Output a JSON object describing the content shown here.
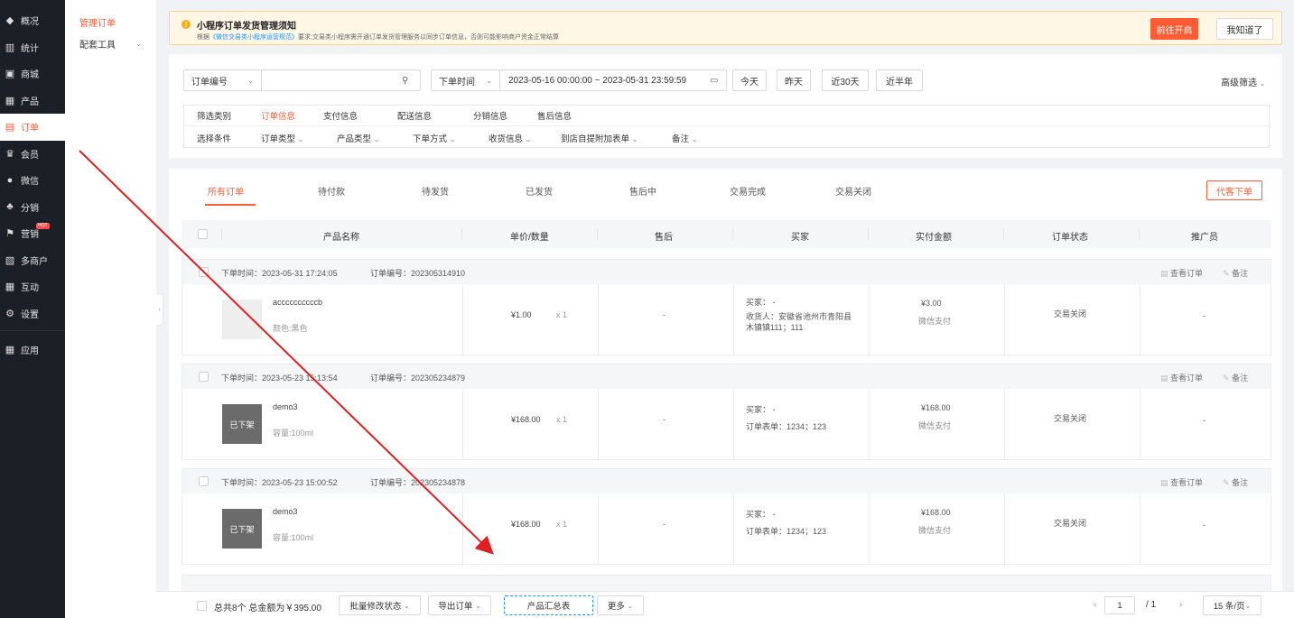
{
  "nav": [
    {
      "icon": "chart-icon",
      "glyph": "◆",
      "label": "概况"
    },
    {
      "icon": "stats-icon",
      "glyph": "▥",
      "label": "统计"
    },
    {
      "icon": "shop-icon",
      "glyph": "▣",
      "label": "商城"
    },
    {
      "icon": "product-icon",
      "glyph": "▦",
      "label": "产品"
    },
    {
      "icon": "order-icon",
      "glyph": "▤",
      "label": "订单",
      "active": true
    },
    {
      "icon": "crown-icon",
      "glyph": "♛",
      "label": "会员"
    },
    {
      "icon": "wechat-icon",
      "glyph": "●",
      "label": "微信"
    },
    {
      "icon": "distribution-icon",
      "glyph": "♣",
      "label": "分销"
    },
    {
      "icon": "flag-icon",
      "glyph": "⚑",
      "label": "营销",
      "badge": "HOT"
    },
    {
      "icon": "multi-store-icon",
      "glyph": "▧",
      "label": "多商户"
    },
    {
      "icon": "interact-icon",
      "glyph": "▦",
      "label": "互动"
    },
    {
      "icon": "settings-icon",
      "glyph": "⚙",
      "label": "设置"
    },
    {
      "icon": "apps-icon",
      "glyph": "▦",
      "label": "应用"
    }
  ],
  "subnav": {
    "manage": "管理订单",
    "tools": "配套工具"
  },
  "notice": {
    "title": "小程序订单发货管理须知",
    "prefix": "根据",
    "link": "《微信交易类小程序运营规范》",
    "body": "要求;交易类小程序需开通订单发货管理服务以同步订单信息，否则可能影响商户资金正常结算",
    "open_btn": "前往开启",
    "ok_btn": "我知道了"
  },
  "filter": {
    "search_type": "订单编号",
    "time_type": "下单时间",
    "date_range": "2023-05-16 00:00:00 ~ 2023-05-31 23:59:59",
    "quick": [
      "今天",
      "昨天",
      "近30天",
      "近半年"
    ],
    "advanced": "高级筛选",
    "cat_label": "筛选类别",
    "cats": [
      "订单信息",
      "支付信息",
      "配送信息",
      "分销信息",
      "售后信息"
    ],
    "cond_label": "选择条件",
    "conds": [
      "订单类型",
      "产品类型",
      "下单方式",
      "收货信息",
      "到店自提附加表单",
      "备注"
    ]
  },
  "tabs": [
    "所有订单",
    "待付款",
    "待发货",
    "已发货",
    "售后中",
    "交易完成",
    "交易关闭"
  ],
  "proxy_order": "代客下单",
  "columns": [
    "产品名称",
    "单价/数量",
    "售后",
    "买家",
    "实付金额",
    "订单状态",
    "推广员"
  ],
  "view_order": "查看订单",
  "remark": "备注",
  "orders": [
    {
      "time": "下单时间：2023-05-31 17:24:05",
      "no": "订单编号：202305314910",
      "product": "accccccccccb",
      "spec": "颜色:黑色",
      "thumb": "",
      "price": "¥1.00",
      "qty": "x 1",
      "aftersale": "-",
      "buyer1": "买家： -",
      "buyer2": "收货人：安徽省池州市青阳县",
      "buyer3": "木镇镇111；111",
      "amount": "¥3.00",
      "pay": "微信支付",
      "status": "交易关闭",
      "promoter": "-"
    },
    {
      "time": "下单时间：2023-05-23 15:13:54",
      "no": "订单编号：202305234879",
      "product": "demo3",
      "spec": "容量:100ml",
      "thumb": "已下架",
      "price": "¥168.00",
      "qty": "x 1",
      "aftersale": "-",
      "buyer1": "买家： -",
      "buyer2": "订单表单：1234；123",
      "buyer3": "",
      "amount": "¥168.00",
      "pay": "微信支付",
      "status": "交易关闭",
      "promoter": "-"
    },
    {
      "time": "下单时间：2023-05-23 15:00:52",
      "no": "订单编号：202305234878",
      "product": "demo3",
      "spec": "容量:100ml",
      "thumb": "已下架",
      "price": "¥168.00",
      "qty": "x 1",
      "aftersale": "-",
      "buyer1": "买家： -",
      "buyer2": "订单表单：1234；123",
      "buyer3": "",
      "amount": "¥168.00",
      "pay": "微信支付",
      "status": "交易关闭",
      "promoter": "-"
    }
  ],
  "footer": {
    "total": "总共8个 总金额为￥395.00",
    "batch": "批量修改状态",
    "export": "导出订单",
    "summary": "产品汇总表",
    "more": "更多",
    "page": "1",
    "pages": "/ 1",
    "per_page": "15 条/页"
  },
  "colors": {
    "accent": "#ff5c35",
    "nav_bg": "#1b1f26",
    "notice_bg": "#fff7e6"
  }
}
